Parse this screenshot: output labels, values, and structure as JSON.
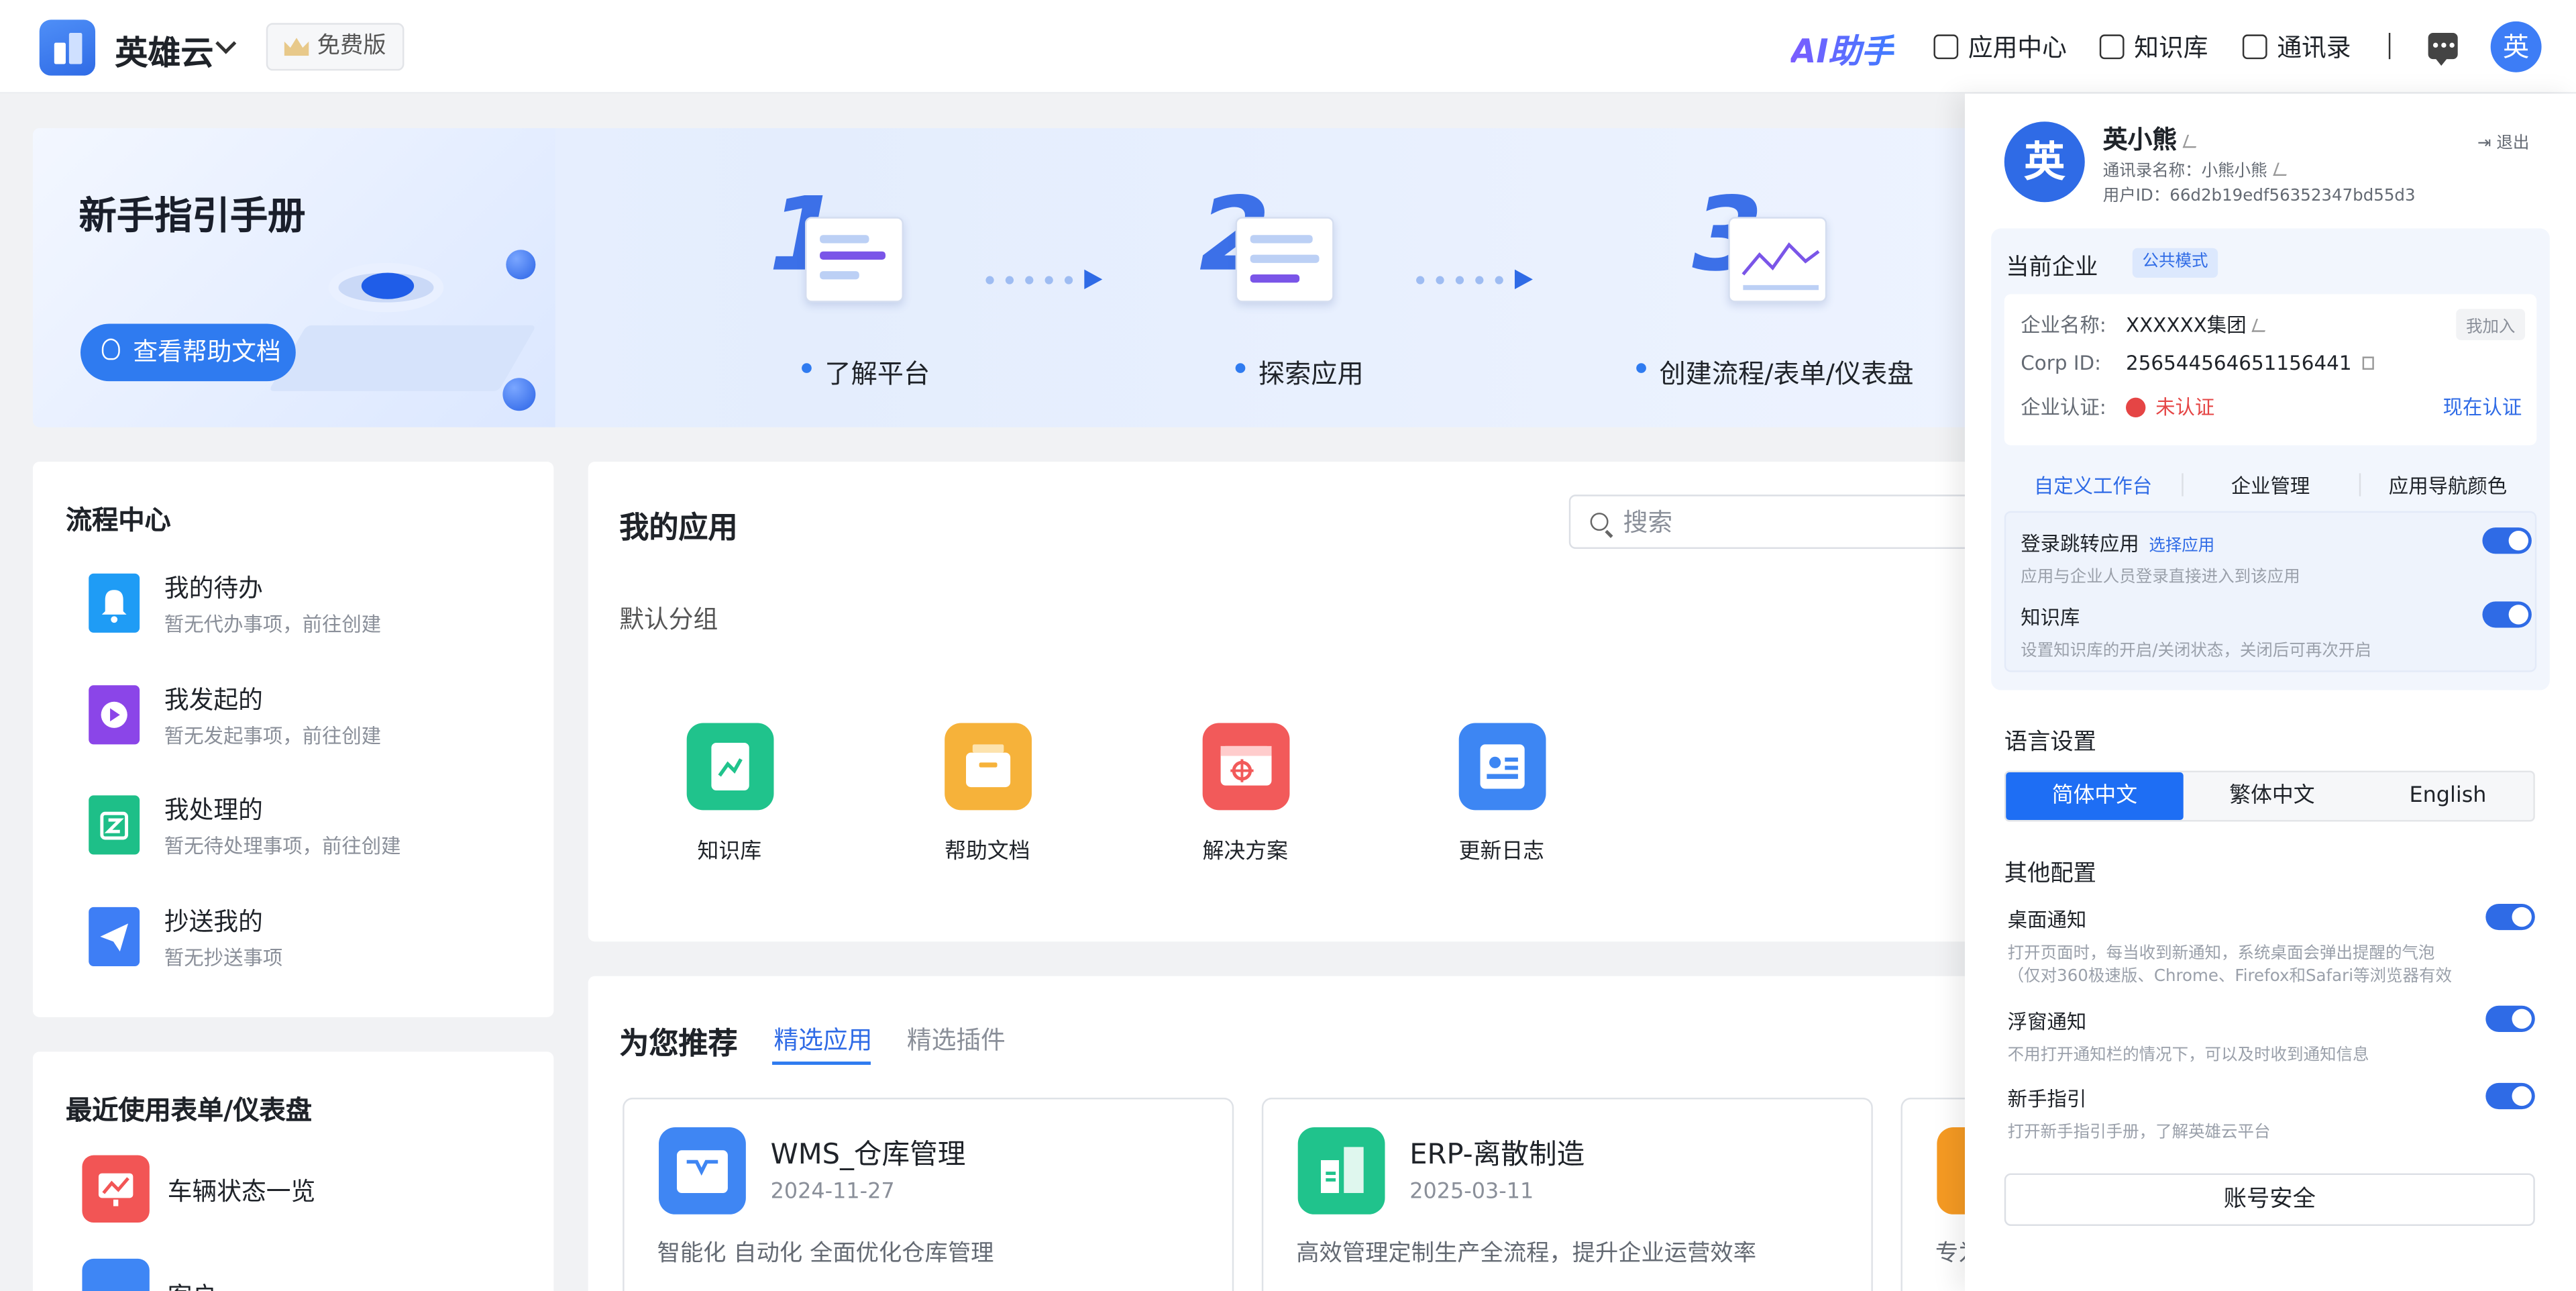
{
  "header": {
    "brand": "英雄云",
    "plan_badge": "免费版",
    "ai_label": "AI助手",
    "nav": [
      {
        "label": "应用中心",
        "icon": "app-center-icon"
      },
      {
        "label": "知识库",
        "icon": "book-icon"
      },
      {
        "label": "通讯录",
        "icon": "contacts-icon"
      }
    ],
    "avatar_text": "英"
  },
  "banner": {
    "title": "新手指引手册",
    "help_button": "查看帮助文档",
    "steps": [
      {
        "num": "1",
        "label": "了解平台"
      },
      {
        "num": "2",
        "label": "探索应用"
      },
      {
        "num": "3",
        "label": "创建流程/表单/仪表盘"
      }
    ]
  },
  "flow_center": {
    "title": "流程中心",
    "items": [
      {
        "name": "我的待办",
        "sub": "暂无代办事项，前往创建",
        "color": "#1f9cf5",
        "icon": "bell-icon"
      },
      {
        "name": "我发起的",
        "sub": "暂无发起事项，前往创建",
        "color": "#8b45e8",
        "icon": "play-icon"
      },
      {
        "name": "我处理的",
        "sub": "暂无待处理事项，前往创建",
        "color": "#1ebf88",
        "icon": "task-icon"
      },
      {
        "name": "抄送我的",
        "sub": "暂无抄送事项",
        "color": "#3e7ef5",
        "icon": "send-icon"
      }
    ]
  },
  "recent": {
    "title": "最近使用表单/仪表盘",
    "items": [
      {
        "name": "车辆状态一览",
        "color": "#f25555",
        "icon": "chart-icon"
      },
      {
        "name": "客户",
        "color": "#3e86f5",
        "icon": "document-icon"
      }
    ]
  },
  "my_apps": {
    "title": "我的应用",
    "search_placeholder": "搜索",
    "group": "默认分组",
    "apps": [
      {
        "name": "知识库",
        "color": "#20c38c",
        "icon": "knowledge-icon"
      },
      {
        "name": "帮助文档",
        "color": "#f6b23a",
        "icon": "help-doc-icon"
      },
      {
        "name": "解决方案",
        "color": "#f25a5a",
        "icon": "solution-icon"
      },
      {
        "name": "更新日志",
        "color": "#3d86f3",
        "icon": "changelog-icon"
      }
    ]
  },
  "recommend": {
    "title": "为您推荐",
    "tabs": [
      "精选应用",
      "精选插件"
    ],
    "cards": [
      {
        "name": "WMS_仓库管理",
        "date": "2024-11-27",
        "desc": "智能化 自动化 全面优化仓库管理",
        "color": "#3f86f3",
        "icon": "warehouse-icon"
      },
      {
        "name": "ERP-离散制造",
        "date": "2025-03-11",
        "desc": "高效管理定制生产全流程，提升企业运营效率",
        "color": "#20c38c",
        "icon": "factory-icon"
      },
      {
        "name": "",
        "date": "",
        "desc": "专为",
        "color": "#f59a23",
        "icon": "user-icon"
      }
    ]
  },
  "drawer": {
    "avatar": "英",
    "user_name": "英小熊",
    "contact_name": "通讯录名称：小熊小熊",
    "user_id": "用户ID：66d2b19edf56352347bd55d3",
    "logout": "退出",
    "enterprise": {
      "title": "当前企业",
      "mode": "公共模式",
      "name_label": "企业名称:",
      "name_value": "XXXXXX集团",
      "join": "我加入",
      "corp_label": "Corp ID:",
      "corp_value": "256544564651156441",
      "cert_label": "企业认证:",
      "cert_value": "未认证",
      "cert_action": "现在认证",
      "tabs": [
        "自定义工作台",
        "企业管理",
        "应用导航颜色"
      ],
      "login_jump": "登录跳转应用",
      "choose_app": "选择应用",
      "login_jump_sub": "应用与企业人员登录直接进入到该应用",
      "kb": "知识库",
      "kb_sub": "设置知识库的开启/关闭状态，关闭后可再次开启"
    },
    "language": {
      "title": "语言设置",
      "options": [
        "简体中文",
        "繁体中文",
        "English"
      ],
      "selected": "简体中文"
    },
    "other": {
      "title": "其他配置",
      "desktop": "桌面通知",
      "desktop_sub1": "打开页面时，每当收到新通知，系统桌面会弹出提醒的气泡",
      "desktop_sub2": "（仅对360极速版、Chrome、Firefox和Safari等浏览器有效",
      "float": "浮窗通知",
      "float_sub": "不用打开通知栏的情况下，可以及时收到通知信息",
      "guide": "新手指引",
      "guide_sub": "打开新手指引手册，了解英雄云平台"
    },
    "account_button": "账号安全"
  }
}
